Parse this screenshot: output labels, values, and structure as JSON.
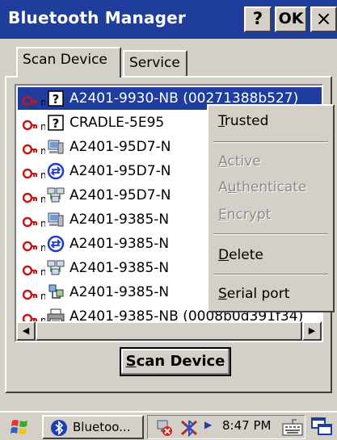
{
  "window": {
    "title": "Bluetooth Manager",
    "help_label": "?",
    "ok_label": "OK",
    "close_label": "×"
  },
  "tabs": [
    {
      "label": "Scan Device",
      "active": true
    },
    {
      "label": "Service",
      "active": false
    }
  ],
  "devices": [
    {
      "name": "A2401-9930-NB (00271388b527)",
      "icon": "unknown-device-icon",
      "selected": true
    },
    {
      "name": "CRADLE-5E95",
      "icon": "unknown-device-icon",
      "selected": false
    },
    {
      "name": "A2401-95D7-N",
      "icon": "computer-icon",
      "selected": false
    },
    {
      "name": "A2401-95D7-N",
      "icon": "bluetooth-network-icon",
      "selected": false
    },
    {
      "name": "A2401-95D7-N",
      "icon": "network-computers-icon",
      "selected": false
    },
    {
      "name": "A2401-9385-N",
      "icon": "computer-icon",
      "selected": false
    },
    {
      "name": "A2401-9385-N",
      "icon": "bluetooth-network-icon",
      "selected": false
    },
    {
      "name": "A2401-9385-N",
      "icon": "network-computers-icon",
      "selected": false
    },
    {
      "name": "A2401-9385-N",
      "icon": "serial-device-icon",
      "selected": false
    },
    {
      "name": "A2401-9385-NB (0008b0d391f34)",
      "icon": "printer-icon",
      "selected": false
    }
  ],
  "context_menu": {
    "items": [
      {
        "label": "Trusted",
        "mnemonic": "T",
        "enabled": true
      },
      {
        "label": "Active",
        "mnemonic": "A",
        "enabled": false
      },
      {
        "label": "Authenticate",
        "mnemonic": "u",
        "enabled": false
      },
      {
        "label": "Encrypt",
        "mnemonic": "E",
        "enabled": false
      },
      {
        "label": "Delete",
        "mnemonic": "D",
        "enabled": true
      },
      {
        "label": "Serial port",
        "mnemonic": "S",
        "enabled": true
      }
    ]
  },
  "scan_button": {
    "label": "Scan Device",
    "mnemonic": "S"
  },
  "taskbar": {
    "app_label": "Bluetoo...",
    "clock": "8:47 PM"
  },
  "colors": {
    "titlebar": "#1e3d9c",
    "selection": "#1e3d9c",
    "face": "#d4d0c8"
  }
}
